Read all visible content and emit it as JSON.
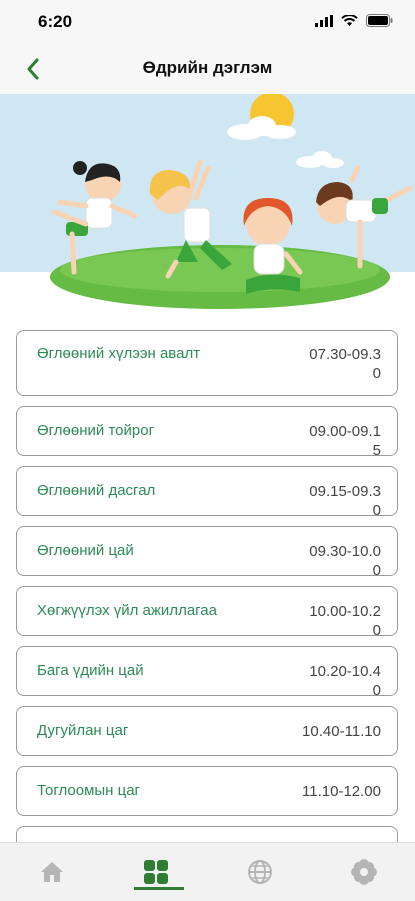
{
  "status_bar": {
    "time": "6:20"
  },
  "header": {
    "title": "Өдрийн дэглэм",
    "back_icon": "chevron-left-icon"
  },
  "schedule": [
    {
      "label": "Өглөөний хүлээн авалт",
      "time": "07.30-09.30"
    },
    {
      "label": "Өглөөний тойрог",
      "time": "09.00-09.15"
    },
    {
      "label": "Өглөөний дасгал",
      "time": "09.15-09.30"
    },
    {
      "label": "Өглөөний цай",
      "time": "09.30-10.00"
    },
    {
      "label": "Хөгжүүлэх үйл ажиллагаа",
      "time": "10.00-10.20"
    },
    {
      "label": "Бага үдийн цай",
      "time": "10.20-10.40"
    },
    {
      "label": "Дугуйлан цаг",
      "time": "10.40-11.10"
    },
    {
      "label": "Тоглоомын цаг",
      "time": "11.10-12.00"
    }
  ],
  "tab_bar": {
    "items": [
      {
        "icon": "home-icon",
        "active": false
      },
      {
        "icon": "grid-icon",
        "active": true
      },
      {
        "icon": "globe-icon",
        "active": false
      },
      {
        "icon": "settings-icon",
        "active": false
      }
    ]
  },
  "colors": {
    "accent_green": "#2e7d32",
    "label_green": "#2e8b57",
    "sky": "#cfe7f3",
    "grass": "#66bb45",
    "sun": "#f7c531"
  }
}
